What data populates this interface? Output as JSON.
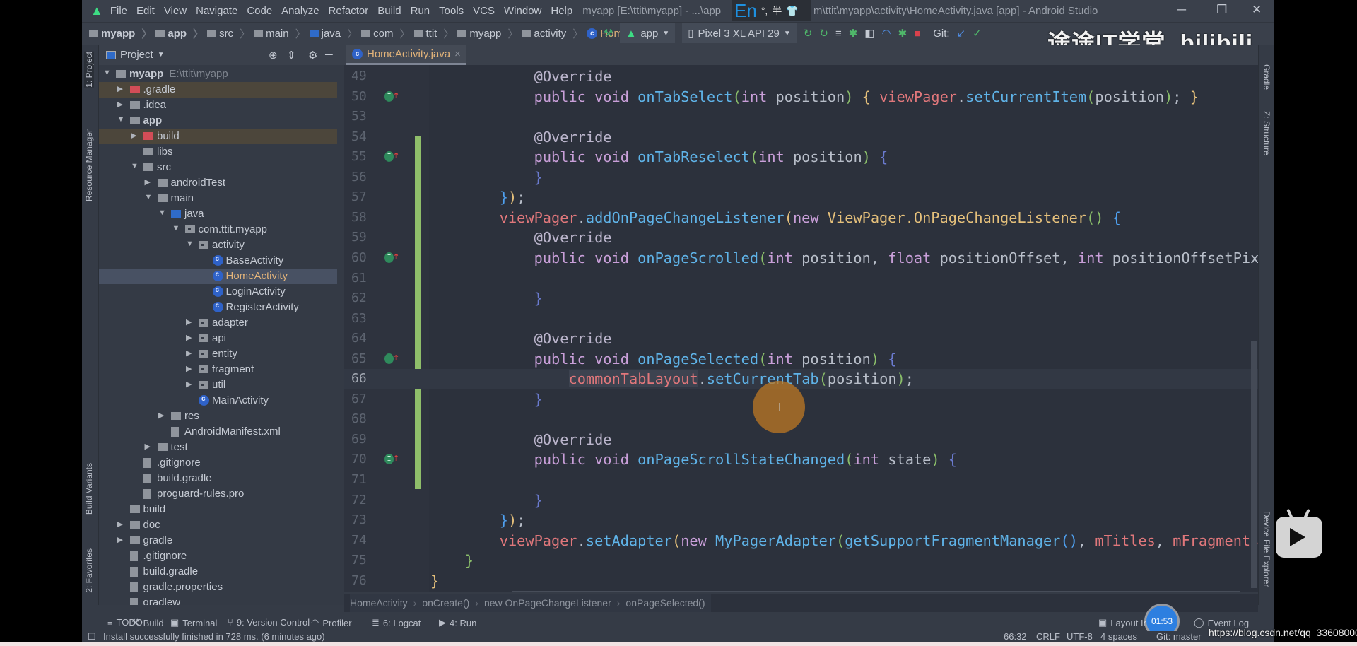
{
  "menu": {
    "items": [
      "File",
      "Edit",
      "View",
      "Navigate",
      "Code",
      "Analyze",
      "Refactor",
      "Build",
      "Run",
      "Tools",
      "VCS",
      "Window",
      "Help"
    ],
    "title_left": "myapp [E:\\ttit\\myapp] - ...\\app",
    "title_right": "m\\ttit\\myapp\\activity\\HomeActivity.java [app] - Android Studio",
    "ime": {
      "lang": "En",
      "punct": "°,",
      "width": "半"
    }
  },
  "nav": {
    "crumbs": [
      "myapp",
      "app",
      "src",
      "main",
      "java",
      "com",
      "ttit",
      "myapp",
      "activity",
      "HomeActivity"
    ]
  },
  "toolbar": {
    "run_config": "app",
    "device": "Pixel 3 XL API 29",
    "git_label": "Git:"
  },
  "watermark": "途途IT学堂 bilibili",
  "left_strip": {
    "project": "1: Project",
    "resource_manager": "Resource Manager",
    "build_variants": "Build Variants",
    "favorites": "2: Favorites"
  },
  "right_strip": {
    "gradle": "Gradle",
    "structure": "Z: Structure",
    "device_file_explorer": "Device File Explorer"
  },
  "project_panel": {
    "title": "Project",
    "tree": [
      {
        "label": "myapp",
        "path": "E:\\ttit\\myapp",
        "level": 0,
        "arrow": "down",
        "icon": "module",
        "bold": true
      },
      {
        "label": ".gradle",
        "level": 1,
        "arrow": "right",
        "icon": "folder-red",
        "state": "ignored"
      },
      {
        "label": ".idea",
        "level": 1,
        "arrow": "right",
        "icon": "folder"
      },
      {
        "label": "app",
        "level": 1,
        "arrow": "down",
        "icon": "module",
        "bold": true
      },
      {
        "label": "build",
        "level": 2,
        "arrow": "right",
        "icon": "folder-red",
        "state": "ignored"
      },
      {
        "label": "libs",
        "level": 2,
        "arrow": "",
        "icon": "folder"
      },
      {
        "label": "src",
        "level": 2,
        "arrow": "down",
        "icon": "folder"
      },
      {
        "label": "androidTest",
        "level": 3,
        "arrow": "right",
        "icon": "folder"
      },
      {
        "label": "main",
        "level": 3,
        "arrow": "down",
        "icon": "folder"
      },
      {
        "label": "java",
        "level": 4,
        "arrow": "down",
        "icon": "folder-blue"
      },
      {
        "label": "com.ttit.myapp",
        "level": 5,
        "arrow": "down",
        "icon": "package"
      },
      {
        "label": "activity",
        "level": 6,
        "arrow": "down",
        "icon": "package"
      },
      {
        "label": "BaseActivity",
        "level": 7,
        "arrow": "",
        "icon": "class"
      },
      {
        "label": "HomeActivity",
        "level": 7,
        "arrow": "",
        "icon": "class",
        "state": "selected"
      },
      {
        "label": "LoginActivity",
        "level": 7,
        "arrow": "",
        "icon": "class"
      },
      {
        "label": "RegisterActivity",
        "level": 7,
        "arrow": "",
        "icon": "class"
      },
      {
        "label": "adapter",
        "level": 6,
        "arrow": "right",
        "icon": "package"
      },
      {
        "label": "api",
        "level": 6,
        "arrow": "right",
        "icon": "package"
      },
      {
        "label": "entity",
        "level": 6,
        "arrow": "right",
        "icon": "package"
      },
      {
        "label": "fragment",
        "level": 6,
        "arrow": "right",
        "icon": "package"
      },
      {
        "label": "util",
        "level": 6,
        "arrow": "right",
        "icon": "package"
      },
      {
        "label": "MainActivity",
        "level": 6,
        "arrow": "",
        "icon": "class"
      },
      {
        "label": "res",
        "level": 4,
        "arrow": "right",
        "icon": "folder"
      },
      {
        "label": "AndroidManifest.xml",
        "level": 4,
        "arrow": "",
        "icon": "file"
      },
      {
        "label": "test",
        "level": 3,
        "arrow": "right",
        "icon": "folder"
      },
      {
        "label": ".gitignore",
        "level": 2,
        "arrow": "",
        "icon": "file"
      },
      {
        "label": "build.gradle",
        "level": 2,
        "arrow": "",
        "icon": "file"
      },
      {
        "label": "proguard-rules.pro",
        "level": 2,
        "arrow": "",
        "icon": "file"
      },
      {
        "label": "build",
        "level": 1,
        "arrow": "",
        "icon": "folder"
      },
      {
        "label": "doc",
        "level": 1,
        "arrow": "right",
        "icon": "folder"
      },
      {
        "label": "gradle",
        "level": 1,
        "arrow": "right",
        "icon": "folder"
      },
      {
        "label": ".gitignore",
        "level": 1,
        "arrow": "",
        "icon": "file"
      },
      {
        "label": "build.gradle",
        "level": 1,
        "arrow": "",
        "icon": "file"
      },
      {
        "label": "gradle.properties",
        "level": 1,
        "arrow": "",
        "icon": "file"
      },
      {
        "label": "gradlew",
        "level": 1,
        "arrow": "",
        "icon": "file"
      }
    ]
  },
  "editor": {
    "tab": "HomeActivity.java",
    "current_line": "66",
    "lines": [
      {
        "n": "49",
        "indent": 12,
        "t": [
          [
            "@Override",
            "ann"
          ]
        ]
      },
      {
        "n": "50",
        "indent": 12,
        "impl": true,
        "t": [
          [
            "public void ",
            "kw"
          ],
          [
            "onTabSelect",
            "fn"
          ],
          [
            "(",
            "b1"
          ],
          [
            "int ",
            "kw"
          ],
          [
            "position",
            "pl"
          ],
          [
            ")",
            "b1"
          ],
          [
            " { ",
            "b2"
          ],
          [
            "viewPager",
            "field"
          ],
          [
            ".",
            "pl"
          ],
          [
            "setCurrentItem",
            "fn"
          ],
          [
            "(",
            "b1"
          ],
          [
            "position",
            "pl"
          ],
          [
            ")",
            "b1"
          ],
          [
            "; ",
            "pl"
          ],
          [
            "}",
            "b2"
          ]
        ]
      },
      {
        "n": "53",
        "indent": 0,
        "t": []
      },
      {
        "n": "54",
        "indent": 12,
        "t": [
          [
            "@Override",
            "ann"
          ]
        ]
      },
      {
        "n": "55",
        "indent": 12,
        "impl": true,
        "t": [
          [
            "public void ",
            "kw"
          ],
          [
            "onTabReselect",
            "fn"
          ],
          [
            "(",
            "b1"
          ],
          [
            "int ",
            "kw"
          ],
          [
            "position",
            "pl"
          ],
          [
            ")",
            "b1"
          ],
          [
            " {",
            "b4"
          ]
        ]
      },
      {
        "n": "56",
        "indent": 12,
        "t": [
          [
            "}",
            "b4"
          ]
        ]
      },
      {
        "n": "57",
        "indent": 8,
        "t": [
          [
            "}",
            "b3"
          ],
          [
            ")",
            "b2"
          ],
          [
            ";",
            "pl"
          ]
        ]
      },
      {
        "n": "58",
        "indent": 8,
        "t": [
          [
            "viewPager",
            "field"
          ],
          [
            ".",
            "pl"
          ],
          [
            "addOnPageChangeListener",
            "fn"
          ],
          [
            "(",
            "b2"
          ],
          [
            "new ",
            "kw"
          ],
          [
            "ViewPager.OnPageChangeListener",
            "type"
          ],
          [
            "()",
            "b1"
          ],
          [
            " {",
            "b3"
          ]
        ]
      },
      {
        "n": "59",
        "indent": 12,
        "t": [
          [
            "@Override",
            "ann"
          ]
        ]
      },
      {
        "n": "60",
        "indent": 12,
        "impl": true,
        "t": [
          [
            "public void ",
            "kw"
          ],
          [
            "onPageScrolled",
            "fn"
          ],
          [
            "(",
            "b1"
          ],
          [
            "int ",
            "kw"
          ],
          [
            "position, ",
            "pl"
          ],
          [
            "float ",
            "kw"
          ],
          [
            "positionOffset, ",
            "pl"
          ],
          [
            "int ",
            "kw"
          ],
          [
            "positionOffsetPixels",
            "pl"
          ],
          [
            ")",
            "b1"
          ],
          [
            " {",
            "b4"
          ]
        ]
      },
      {
        "n": "61",
        "indent": 0,
        "t": []
      },
      {
        "n": "62",
        "indent": 12,
        "t": [
          [
            "}",
            "b4"
          ]
        ]
      },
      {
        "n": "63",
        "indent": 0,
        "t": []
      },
      {
        "n": "64",
        "indent": 12,
        "t": [
          [
            "@Override",
            "ann"
          ]
        ]
      },
      {
        "n": "65",
        "indent": 12,
        "impl": true,
        "t": [
          [
            "public void ",
            "kw"
          ],
          [
            "onPageSelected",
            "fn"
          ],
          [
            "(",
            "b1"
          ],
          [
            "int ",
            "kw"
          ],
          [
            "position",
            "pl"
          ],
          [
            ")",
            "b1"
          ],
          [
            " {",
            "b4"
          ]
        ]
      },
      {
        "n": "66",
        "indent": 16,
        "t": [
          [
            "commonTabLayout",
            "field hl"
          ],
          [
            ".",
            "pl"
          ],
          [
            "setCurrentTab",
            "fn"
          ],
          [
            "(",
            "b1"
          ],
          [
            "position",
            "pl"
          ],
          [
            ")",
            "b1"
          ],
          [
            ";",
            "pl"
          ]
        ]
      },
      {
        "n": "67",
        "indent": 12,
        "t": [
          [
            "}",
            "b4"
          ]
        ]
      },
      {
        "n": "68",
        "indent": 0,
        "t": []
      },
      {
        "n": "69",
        "indent": 12,
        "t": [
          [
            "@Override",
            "ann"
          ]
        ]
      },
      {
        "n": "70",
        "indent": 12,
        "impl": true,
        "t": [
          [
            "public void ",
            "kw"
          ],
          [
            "onPageScrollStateChanged",
            "fn"
          ],
          [
            "(",
            "b1"
          ],
          [
            "int ",
            "kw"
          ],
          [
            "state",
            "pl"
          ],
          [
            ")",
            "b1"
          ],
          [
            " {",
            "b4"
          ]
        ]
      },
      {
        "n": "71",
        "indent": 0,
        "t": []
      },
      {
        "n": "72",
        "indent": 12,
        "t": [
          [
            "}",
            "b4"
          ]
        ]
      },
      {
        "n": "73",
        "indent": 8,
        "t": [
          [
            "}",
            "b3"
          ],
          [
            ")",
            "b2"
          ],
          [
            ";",
            "pl"
          ]
        ]
      },
      {
        "n": "74",
        "indent": 8,
        "t": [
          [
            "viewPager",
            "field"
          ],
          [
            ".",
            "pl"
          ],
          [
            "setAdapter",
            "fn"
          ],
          [
            "(",
            "b2"
          ],
          [
            "new ",
            "kw"
          ],
          [
            "MyPagerAdapter",
            "fn"
          ],
          [
            "(",
            "b1"
          ],
          [
            "getSupportFragmentManager",
            "fn"
          ],
          [
            "()",
            "b3"
          ],
          [
            ", ",
            "pl"
          ],
          [
            "mTitles",
            "field"
          ],
          [
            ", ",
            "pl"
          ],
          [
            "mFragments",
            "field"
          ],
          [
            ")",
            "b1"
          ],
          [
            ")",
            "b2"
          ],
          [
            ";",
            "pl"
          ]
        ]
      },
      {
        "n": "75",
        "indent": 4,
        "t": [
          [
            "}",
            "b1"
          ]
        ]
      },
      {
        "n": "76",
        "indent": 0,
        "t": [
          [
            "}",
            "b2"
          ]
        ]
      }
    ],
    "breadcrumb": [
      "HomeActivity",
      "onCreate()",
      "new OnPageChangeListener",
      "onPageSelected()"
    ]
  },
  "tool_windows": {
    "left": [
      {
        "icon": "todo-icon",
        "label": "TODO"
      },
      {
        "icon": "build-icon",
        "label": "Build"
      },
      {
        "icon": "terminal-icon",
        "label": "Terminal"
      },
      {
        "icon": "version-control-icon",
        "label": "9: Version Control"
      },
      {
        "icon": "profiler-icon",
        "label": "Profiler"
      },
      {
        "icon": "logcat-icon",
        "label": "6: Logcat"
      },
      {
        "icon": "run-icon",
        "label": "4: Run"
      }
    ],
    "layout_inspector": "Layout In",
    "event_log": "Event Log",
    "timer": "01:53"
  },
  "status": {
    "message": "Install successfully finished in 728 ms. (6 minutes ago)",
    "position": "66:32",
    "line_sep": "CRLF",
    "encoding": "UTF-8",
    "indent": "4 spaces",
    "git": "Git: master"
  },
  "overlay_url": "https://blog.csdn.net/qq_33608000",
  "colors": {
    "editor_bg": "#2c313c",
    "keyword": "#c99fd9",
    "method": "#5fb3e8",
    "field": "#e0777b",
    "type": "#e5c07b",
    "change_bar": "#8fbe6a",
    "selected_file": "#e3b47a"
  }
}
